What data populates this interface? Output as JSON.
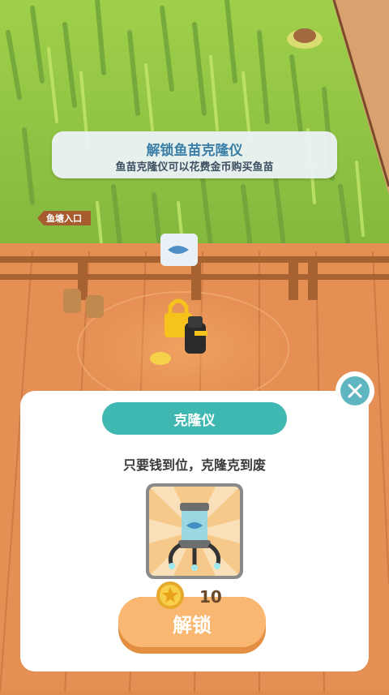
{
  "hint_banner": {
    "title": "解锁鱼苗克隆仪",
    "subtitle": "鱼苗克隆仪可以花费金币购买鱼苗"
  },
  "signpost": {
    "label": "鱼塘入口"
  },
  "unlock_panel": {
    "name": "克隆仪",
    "description": "只要钱到位，克隆克到废",
    "item_icon": "clone-machine-icon",
    "price": "10",
    "unlock_label": "解锁",
    "close_icon": "close-icon"
  },
  "colors": {
    "accent_teal": "#3eb8b0",
    "unlock_button": "#f9b772",
    "title_blue": "#3c7fa8"
  }
}
